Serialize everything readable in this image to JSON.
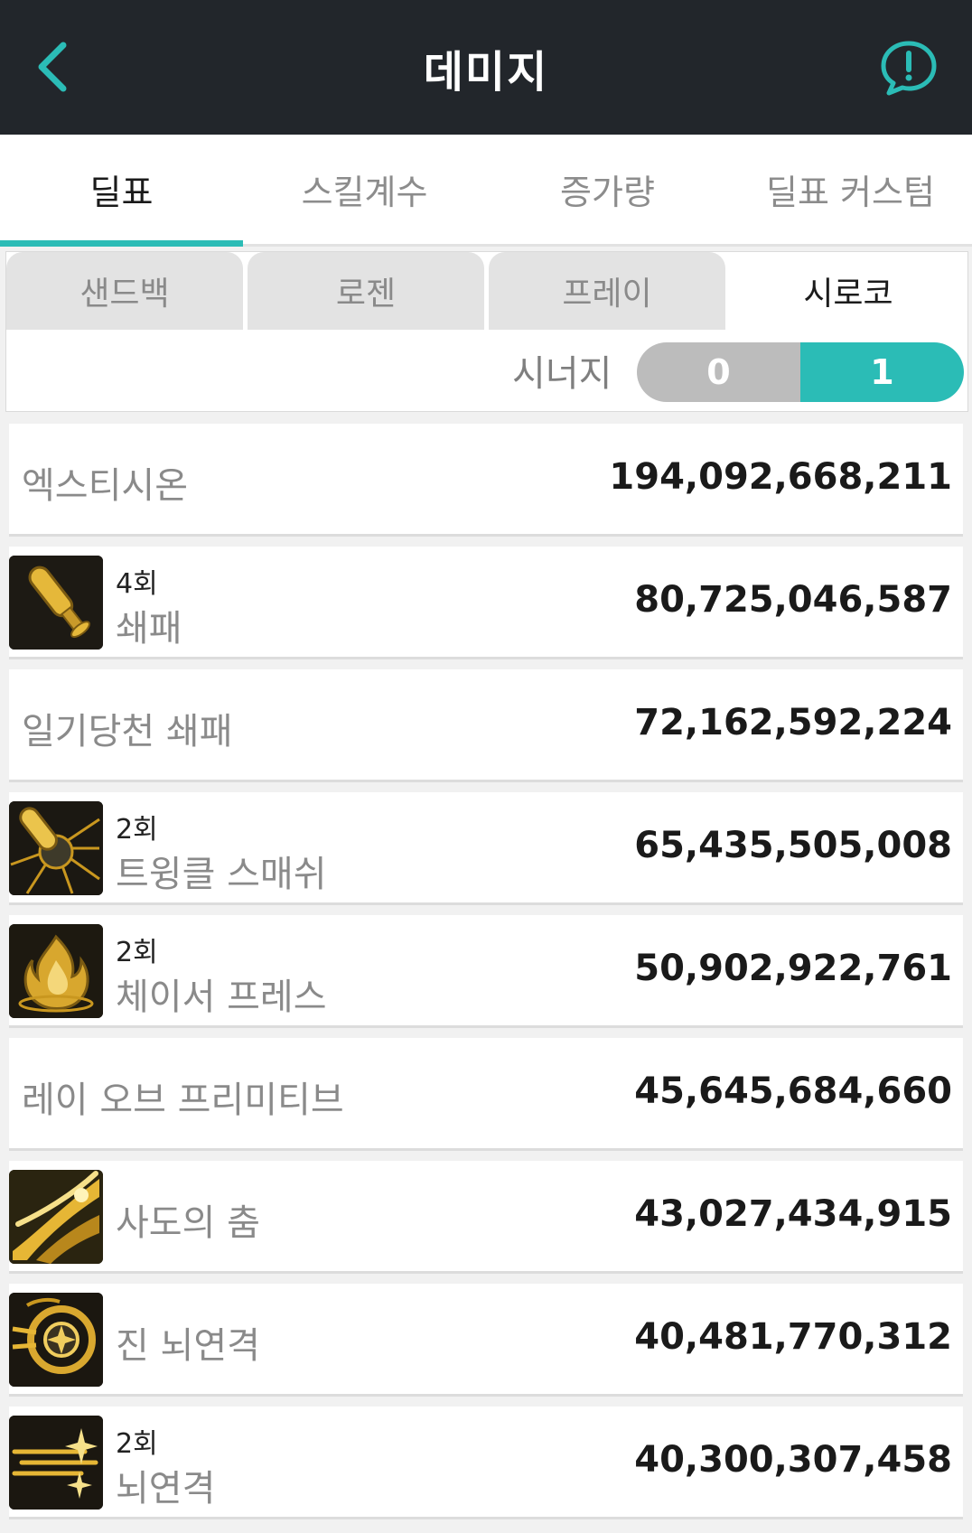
{
  "header": {
    "title": "데미지",
    "accent_color": "#2bbcb6",
    "background_color": "#22262b",
    "back_icon": "chevron-left-icon",
    "info_icon": "alert-chat-icon"
  },
  "main_tabs": [
    {
      "label": "딜표",
      "active": true
    },
    {
      "label": "스킬계수",
      "active": false
    },
    {
      "label": "증가량",
      "active": false
    },
    {
      "label": "딜표 커스텀",
      "active": false
    }
  ],
  "boss_tabs": [
    {
      "label": "샌드백",
      "active": false
    },
    {
      "label": "로젠",
      "active": false
    },
    {
      "label": "프레이",
      "active": false
    },
    {
      "label": "시로코",
      "active": true
    }
  ],
  "synergy": {
    "label": "시너지",
    "options": [
      "0",
      "1"
    ],
    "selected": "1"
  },
  "damage_rows": [
    {
      "name": "엑스티시온",
      "value": "194,092,668,211",
      "count": null,
      "icon": null
    },
    {
      "name": "쇄패",
      "value": "80,725,046,587",
      "count": "4회",
      "icon": "bat-skill-icon"
    },
    {
      "name": "일기당천 쇄패",
      "value": "72,162,592,224",
      "count": null,
      "icon": null
    },
    {
      "name": "트윙클 스매쉬",
      "value": "65,435,505,008",
      "count": "2회",
      "icon": "twinkle-smash-skill-icon"
    },
    {
      "name": "체이서 프레스",
      "value": "50,902,922,761",
      "count": "2회",
      "icon": "chaser-press-skill-icon"
    },
    {
      "name": "레이 오브 프리미티브",
      "value": "45,645,684,660",
      "count": null,
      "icon": null
    },
    {
      "name": "사도의 춤",
      "value": "43,027,434,915",
      "count": null,
      "icon": "apostle-dance-skill-icon"
    },
    {
      "name": "진 뇌연격",
      "value": "40,481,770,312",
      "count": null,
      "icon": "true-thunder-strike-skill-icon"
    },
    {
      "name": "뇌연격",
      "value": "40,300,307,458",
      "count": "2회",
      "icon": "thunder-strike-skill-icon"
    }
  ]
}
